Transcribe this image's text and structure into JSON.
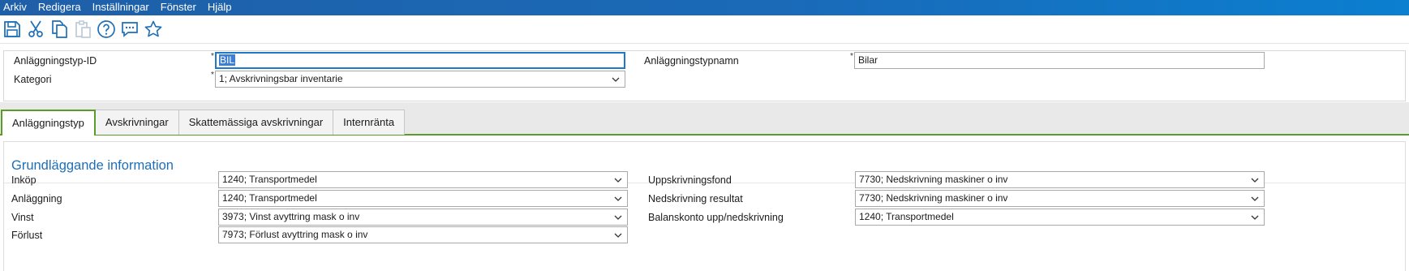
{
  "menu": [
    "Arkiv",
    "Redigera",
    "Inställningar",
    "Fönster",
    "Hjälp"
  ],
  "toolbar": [
    {
      "icon": "save-icon"
    },
    {
      "icon": "cut-icon"
    },
    {
      "icon": "copy-icon"
    },
    {
      "icon": "paste-icon",
      "disabled": true
    },
    {
      "icon": "help-icon"
    },
    {
      "icon": "comment-icon"
    },
    {
      "icon": "star-icon"
    }
  ],
  "header": {
    "type_id_label": "Anläggningstyp-ID",
    "type_id_value": "BIL",
    "category_label": "Kategori",
    "category_value": "1; Avskrivningsbar inventarie",
    "type_name_label": "Anläggningstypnamn",
    "type_name_value": "Bilar",
    "required_mark": "*"
  },
  "tabs": [
    {
      "label": "Anläggningstyp",
      "active": true
    },
    {
      "label": "Avskrivningar",
      "active": false
    },
    {
      "label": "Skattemässiga avskrivningar",
      "active": false
    },
    {
      "label": "Internränta",
      "active": false
    }
  ],
  "section": {
    "title": "Grundläggande information",
    "left_fields": [
      {
        "label": "Inköp",
        "value": "1240; Transportmedel"
      },
      {
        "label": "Anläggning",
        "value": "1240; Transportmedel"
      },
      {
        "label": "Vinst",
        "value": "3973; Vinst avyttring mask o inv"
      },
      {
        "label": "Förlust",
        "value": "7973; Förlust avyttring mask o inv"
      }
    ],
    "right_fields": [
      {
        "label": "Uppskrivningsfond",
        "value": "7730; Nedskrivning maskiner o inv"
      },
      {
        "label": "Nedskrivning resultat",
        "value": "7730; Nedskrivning maskiner o inv"
      },
      {
        "label": "Balanskonto upp/nedskrivning",
        "value": "1240; Transportmedel"
      }
    ]
  },
  "colors": {
    "menubar": "#1a6ab8",
    "accent_tab": "#5a9b2a",
    "section_title": "#1f6fb8",
    "focus": "#1f78c8"
  }
}
